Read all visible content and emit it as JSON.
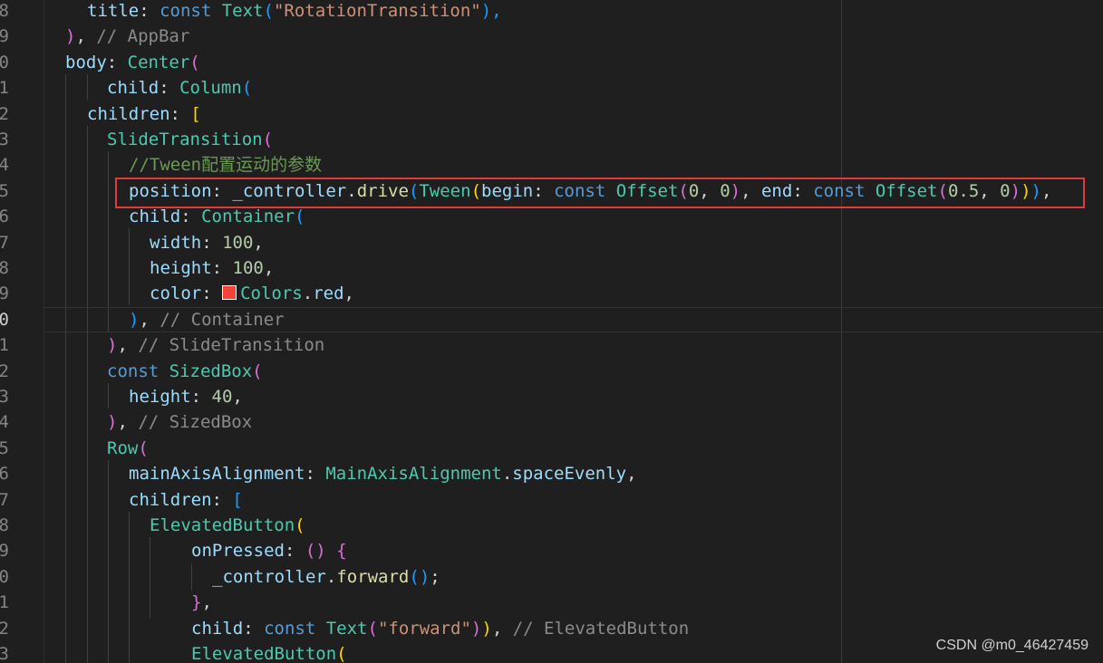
{
  "editor": {
    "lines": [
      {
        "num": "8",
        "indent": 96,
        "tokens": [
          [
            "p",
            "title"
          ],
          [
            "d",
            ": "
          ],
          [
            "k",
            "const "
          ],
          [
            "c",
            "Text"
          ],
          [
            "b3",
            "("
          ],
          [
            "s",
            "\"RotationTransition\""
          ],
          [
            "b3",
            "),"
          ]
        ]
      },
      {
        "num": "9",
        "indent": 72,
        "tokens": [
          [
            "b2",
            ")"
          ],
          [
            "d",
            ", "
          ],
          [
            "cm2",
            "// AppBar"
          ]
        ]
      },
      {
        "num": "0",
        "indent": 72,
        "tokens": [
          [
            "p",
            "body"
          ],
          [
            "d",
            ": "
          ],
          [
            "c",
            "Center"
          ],
          [
            "b2",
            "("
          ]
        ]
      },
      {
        "num": "1",
        "indent": 118,
        "tokens": [
          [
            "p",
            "child"
          ],
          [
            "d",
            ": "
          ],
          [
            "c",
            "Column"
          ],
          [
            "b3",
            "("
          ]
        ]
      },
      {
        "num": "2",
        "indent": 96,
        "tokens": [
          [
            "p",
            "children"
          ],
          [
            "d",
            ": "
          ],
          [
            "b1",
            "["
          ]
        ]
      },
      {
        "num": "3",
        "indent": 118,
        "tokens": [
          [
            "c",
            "SlideTransition"
          ],
          [
            "b2",
            "("
          ]
        ]
      },
      {
        "num": "4",
        "indent": 142,
        "tokens": [
          [
            "cm",
            "//Tween配置运动的参数"
          ]
        ]
      },
      {
        "num": "5",
        "indent": 142,
        "tokens": [
          [
            "p",
            "position"
          ],
          [
            "d",
            ": "
          ],
          [
            "p",
            "_controller"
          ],
          [
            "d",
            "."
          ],
          [
            "f",
            "drive"
          ],
          [
            "b3",
            "("
          ],
          [
            "c",
            "Tween"
          ],
          [
            "b1",
            "("
          ],
          [
            "p",
            "begin"
          ],
          [
            "d",
            ": "
          ],
          [
            "k",
            "const "
          ],
          [
            "c",
            "Offset"
          ],
          [
            "b2",
            "("
          ],
          [
            "n",
            "0"
          ],
          [
            "d",
            ", "
          ],
          [
            "n",
            "0"
          ],
          [
            "b2",
            ")"
          ],
          [
            "d",
            ", "
          ],
          [
            "p",
            "end"
          ],
          [
            "d",
            ": "
          ],
          [
            "k",
            "const "
          ],
          [
            "c",
            "Offset"
          ],
          [
            "b2",
            "("
          ],
          [
            "n",
            "0.5"
          ],
          [
            "d",
            ", "
          ],
          [
            "n",
            "0"
          ],
          [
            "b2",
            ")"
          ],
          [
            "b1",
            ")"
          ],
          [
            "b3",
            ")"
          ],
          [
            "d",
            ","
          ]
        ]
      },
      {
        "num": "6",
        "indent": 142,
        "tokens": [
          [
            "p",
            "child"
          ],
          [
            "d",
            ": "
          ],
          [
            "c",
            "Container"
          ],
          [
            "b3",
            "("
          ]
        ]
      },
      {
        "num": "7",
        "indent": 165,
        "tokens": [
          [
            "p",
            "width"
          ],
          [
            "d",
            ": "
          ],
          [
            "n",
            "100"
          ],
          [
            "d",
            ","
          ]
        ]
      },
      {
        "num": "8",
        "indent": 165,
        "tokens": [
          [
            "p",
            "height"
          ],
          [
            "d",
            ": "
          ],
          [
            "n",
            "100"
          ],
          [
            "d",
            ","
          ]
        ]
      },
      {
        "num": "9",
        "indent": 165,
        "tokens": [
          [
            "p",
            "color"
          ],
          [
            "d",
            ": "
          ],
          [
            "swatch",
            ""
          ],
          [
            "c",
            "Colors"
          ],
          [
            "d",
            "."
          ],
          [
            "p",
            "red"
          ],
          [
            "d",
            ","
          ]
        ]
      },
      {
        "num": "0",
        "indent": 142,
        "tokens": [
          [
            "b3",
            ")"
          ],
          [
            "d",
            ", "
          ],
          [
            "cm2",
            "// Container"
          ]
        ]
      },
      {
        "num": "1",
        "indent": 118,
        "tokens": [
          [
            "b2",
            ")"
          ],
          [
            "d",
            ", "
          ],
          [
            "cm2",
            "// SlideTransition"
          ]
        ]
      },
      {
        "num": "2",
        "indent": 118,
        "tokens": [
          [
            "k",
            "const "
          ],
          [
            "c",
            "SizedBox"
          ],
          [
            "b2",
            "("
          ]
        ]
      },
      {
        "num": "3",
        "indent": 142,
        "tokens": [
          [
            "p",
            "height"
          ],
          [
            "d",
            ": "
          ],
          [
            "n",
            "40"
          ],
          [
            "d",
            ","
          ]
        ]
      },
      {
        "num": "4",
        "indent": 118,
        "tokens": [
          [
            "b2",
            ")"
          ],
          [
            "d",
            ", "
          ],
          [
            "cm2",
            "// SizedBox"
          ]
        ]
      },
      {
        "num": "5",
        "indent": 118,
        "tokens": [
          [
            "c",
            "Row"
          ],
          [
            "b2",
            "("
          ]
        ]
      },
      {
        "num": "6",
        "indent": 142,
        "tokens": [
          [
            "p",
            "mainAxisAlignment"
          ],
          [
            "d",
            ": "
          ],
          [
            "c",
            "MainAxisAlignment"
          ],
          [
            "d",
            "."
          ],
          [
            "p",
            "spaceEvenly"
          ],
          [
            "d",
            ","
          ]
        ]
      },
      {
        "num": "7",
        "indent": 142,
        "tokens": [
          [
            "p",
            "children"
          ],
          [
            "d",
            ": "
          ],
          [
            "b3",
            "["
          ]
        ]
      },
      {
        "num": "8",
        "indent": 165,
        "tokens": [
          [
            "c",
            "ElevatedButton"
          ],
          [
            "b1",
            "("
          ]
        ]
      },
      {
        "num": "9",
        "indent": 211,
        "tokens": [
          [
            "p",
            "onPressed"
          ],
          [
            "d",
            ": "
          ],
          [
            "b2",
            "()"
          ],
          [
            "d",
            " "
          ],
          [
            "b2",
            "{"
          ]
        ]
      },
      {
        "num": "0",
        "indent": 234,
        "tokens": [
          [
            "p",
            "_controller"
          ],
          [
            "d",
            "."
          ],
          [
            "f",
            "forward"
          ],
          [
            "b3",
            "()"
          ],
          [
            "d",
            ";"
          ]
        ]
      },
      {
        "num": "1",
        "indent": 211,
        "tokens": [
          [
            "b2",
            "}"
          ],
          [
            "d",
            ","
          ]
        ]
      },
      {
        "num": "2",
        "indent": 211,
        "tokens": [
          [
            "p",
            "child"
          ],
          [
            "d",
            ": "
          ],
          [
            "k",
            "const "
          ],
          [
            "c",
            "Text"
          ],
          [
            "b2",
            "("
          ],
          [
            "s",
            "\"forward\""
          ],
          [
            "b2",
            ")"
          ],
          [
            "b1",
            ")"
          ],
          [
            "d",
            ", "
          ],
          [
            "cm2",
            "// ElevatedButton"
          ]
        ]
      },
      {
        "num": "3",
        "indent": 211,
        "tokens": [
          [
            "c",
            "ElevatedButton"
          ],
          [
            "b1",
            "("
          ]
        ]
      }
    ]
  },
  "watermark": "CSDN @m0_46427459",
  "colors": {
    "background": "#1f1f1f",
    "highlight_box": "#e0393e",
    "swatch_red": "#f44336"
  }
}
